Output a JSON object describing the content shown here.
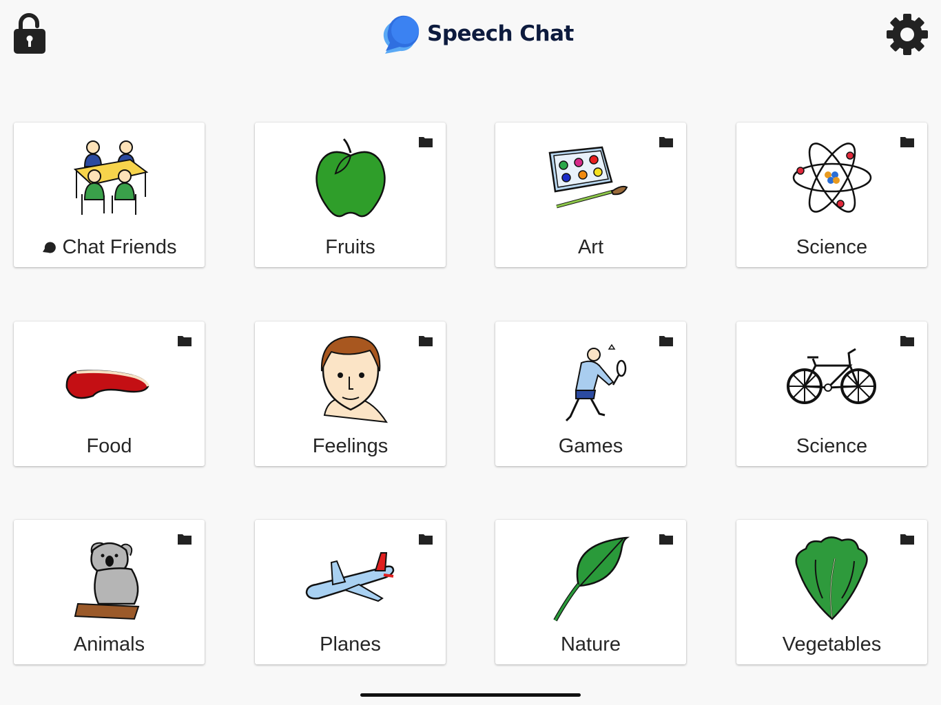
{
  "app": {
    "title": "Speech Chat",
    "brand_color": "#2f7df6",
    "title_color": "#0d1b3e"
  },
  "header": {
    "lock_icon": "unlocked-padlock-icon",
    "settings_icon": "gear-icon"
  },
  "tiles": [
    {
      "label": "Chat Friends",
      "icon": "people-at-table-icon",
      "folder": false,
      "chat_badge": true
    },
    {
      "label": "Fruits",
      "icon": "green-apple-icon",
      "folder": true
    },
    {
      "label": "Art",
      "icon": "paint-palette-icon",
      "folder": true
    },
    {
      "label": "Science",
      "icon": "atom-icon",
      "folder": true
    },
    {
      "label": "Food",
      "icon": "steak-icon",
      "folder": true
    },
    {
      "label": "Feelings",
      "icon": "face-icon",
      "folder": true
    },
    {
      "label": "Games",
      "icon": "badminton-player-icon",
      "folder": true
    },
    {
      "label": "Science",
      "icon": "bicycle-icon",
      "folder": true
    },
    {
      "label": "Animals",
      "icon": "koala-icon",
      "folder": true
    },
    {
      "label": "Planes",
      "icon": "airplane-icon",
      "folder": true
    },
    {
      "label": "Nature",
      "icon": "leaf-icon",
      "folder": true
    },
    {
      "label": "Vegetables",
      "icon": "lettuce-icon",
      "folder": true
    }
  ]
}
